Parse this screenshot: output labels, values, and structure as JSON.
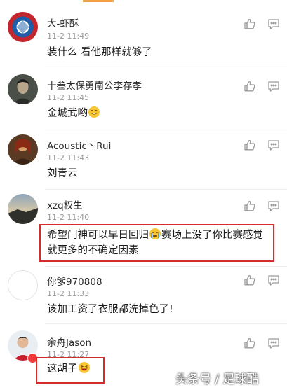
{
  "comments": [
    {
      "user": "大-虾酥",
      "time": "11-2 11:49",
      "text": "装什么 看他那样就够了"
    },
    {
      "user": "十叁太保勇南公李存孝",
      "time": "11-2 11:45",
      "text": "金城武哟"
    },
    {
      "user": "Acoustic丶Rui",
      "time": "11-2 11:43",
      "text": "刘青云"
    },
    {
      "user": "xzq权生",
      "time": "11-2 11:40",
      "text_line1_a": "希望门神可以早日回归",
      "text_line1_b": "赛场上没了你比赛感觉",
      "text_line2": "就更多的不确定因素"
    },
    {
      "user": "你爹970808",
      "time": "11-2 11:33",
      "text": "该加工资了衣服都洗掉色了!"
    },
    {
      "user": "余舟Jason",
      "time": "11-2 11:27",
      "text": "这胡子"
    }
  ],
  "watermark": "头条号 / 足球酷",
  "icons": {
    "like": "thumbs-up-icon",
    "reply": "comment-icon"
  },
  "colors": {
    "highlight": "#d62c2c",
    "accent": "#f0a24b",
    "badge": "#f03a3a"
  }
}
